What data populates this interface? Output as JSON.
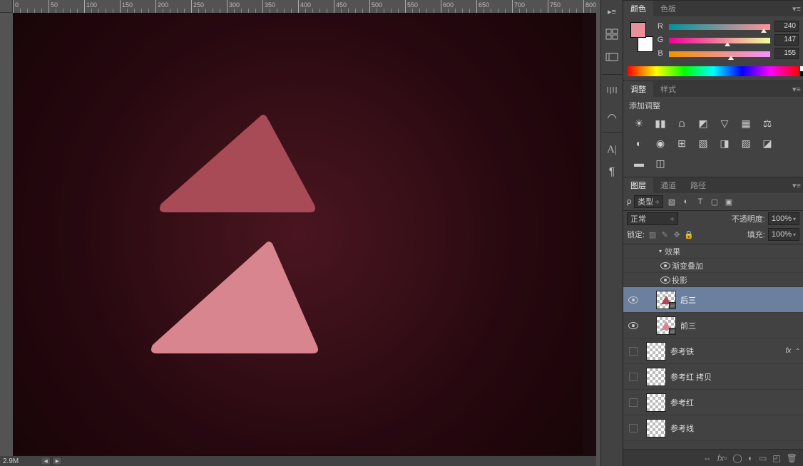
{
  "ruler": {
    "marks": [
      0,
      50,
      100,
      150,
      200,
      250,
      300,
      350,
      400,
      450,
      500,
      550,
      600,
      650,
      700,
      750,
      800
    ]
  },
  "status": {
    "zoom": "2.9M"
  },
  "color_panel": {
    "tab_color": "颜色",
    "tab_swatches": "色板",
    "r_label": "R",
    "g_label": "G",
    "b_label": "B",
    "r": 240,
    "g": 147,
    "b": 155
  },
  "adjust_panel": {
    "tab_adjust": "调整",
    "tab_styles": "样式",
    "add_label": "添加调整"
  },
  "layers_panel": {
    "tab_layers": "图层",
    "tab_channels": "通道",
    "tab_paths": "路径",
    "filter_label": "类型",
    "blend": "正常",
    "opacity_label": "不透明度:",
    "opacity": "100%",
    "lock_label": "锁定:",
    "fill_label": "填充:",
    "fill": "100%",
    "fx_group_label": "效果",
    "fx_grad": "渐变叠加",
    "fx_shadow": "投影",
    "layers": [
      {
        "name": "后三",
        "selected": true,
        "visible": true,
        "shape": true,
        "color": "#a94b56"
      },
      {
        "name": "前三",
        "selected": false,
        "visible": true,
        "shape": true,
        "color": "#d8858f"
      },
      {
        "name": "参考铁",
        "selected": false,
        "visible": false,
        "shape": false,
        "fx": true,
        "color": ""
      },
      {
        "name": "参考红 拷贝",
        "selected": false,
        "visible": false,
        "shape": false,
        "color": ""
      },
      {
        "name": "参考红",
        "selected": false,
        "visible": false,
        "shape": false,
        "color": ""
      },
      {
        "name": "参考线",
        "selected": false,
        "visible": false,
        "shape": false,
        "color": ""
      }
    ],
    "fx_label": "fx"
  }
}
